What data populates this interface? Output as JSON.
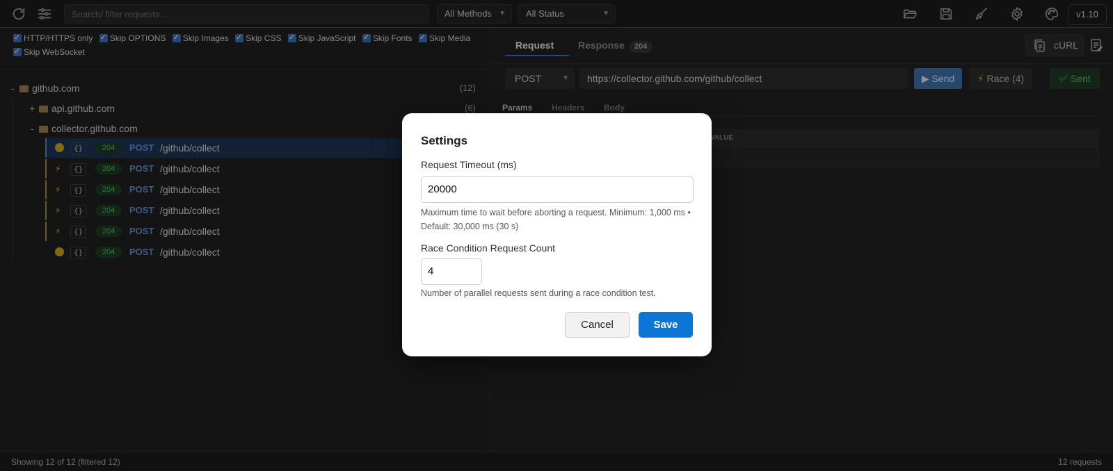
{
  "toolbar": {
    "search_placeholder": "Search/ filter requests...",
    "methods_filter": "All Methods",
    "status_filter": "All Status",
    "version": "v1.10",
    "icons": [
      "refresh-icon",
      "sliders-icon",
      "folder-open-icon",
      "save-icon",
      "broom-icon",
      "gear-icon",
      "palette-icon"
    ]
  },
  "filters": [
    {
      "label": "HTTP/HTTPS only",
      "checked": true
    },
    {
      "label": "Skip OPTIONS",
      "checked": true
    },
    {
      "label": "Skip Images",
      "checked": true
    },
    {
      "label": "Skip CSS",
      "checked": true
    },
    {
      "label": "Skip JavaScript",
      "checked": true
    },
    {
      "label": "Skip Fonts",
      "checked": true
    },
    {
      "label": "Skip Media",
      "checked": true
    },
    {
      "label": "Skip WebSocket",
      "checked": true
    }
  ],
  "tree": {
    "root": {
      "toggle": "-",
      "label": "github.com",
      "count": "(12)"
    },
    "children": [
      {
        "toggle": "+",
        "label": "api.github.com",
        "count": "(6)"
      },
      {
        "toggle": "-",
        "label": "collector.github.com",
        "count": ""
      }
    ],
    "requests": [
      {
        "marker": "dot",
        "type": "{}",
        "status": "204",
        "method": "POST",
        "path": "/github/collect",
        "selected": true
      },
      {
        "marker": "bolt",
        "type": "{}",
        "status": "204",
        "method": "POST",
        "path": "/github/collect",
        "selected": false
      },
      {
        "marker": "bolt",
        "type": "{}",
        "status": "204",
        "method": "POST",
        "path": "/github/collect",
        "selected": false
      },
      {
        "marker": "bolt",
        "type": "{}",
        "status": "204",
        "method": "POST",
        "path": "/github/collect",
        "selected": false
      },
      {
        "marker": "bolt",
        "type": "{}",
        "status": "204",
        "method": "POST",
        "path": "/github/collect",
        "selected": false
      },
      {
        "marker": "dot",
        "type": "{}",
        "status": "204",
        "method": "POST",
        "path": "/github/collect",
        "selected": false
      }
    ]
  },
  "request_panel": {
    "tabs": {
      "request": "Request",
      "response": "Response",
      "response_badge": "204"
    },
    "curl_label": "cURL",
    "method": "POST",
    "url": "https://collector.github.com/github/collect",
    "send_label": "Send",
    "race_label": "Race (4)",
    "sent_label": "Sent",
    "subtabs": {
      "params": "Params",
      "headers": "Headers",
      "body": "Body"
    },
    "params_value_header": "VALUE"
  },
  "statusbar": {
    "left": "Showing 12 of 12 (filtered 12)",
    "right": "12 requests"
  },
  "modal": {
    "title": "Settings",
    "timeout_label": "Request Timeout (ms)",
    "timeout_value": "20000",
    "timeout_help": "Maximum time to wait before aborting a request. Minimum: 1,000 ms • Default: 30,000 ms (30 s)",
    "race_label": "Race Condition Request Count",
    "race_value": "4",
    "race_help": "Number of parallel requests sent during a race condition test.",
    "cancel_label": "Cancel",
    "save_label": "Save"
  },
  "colors": {
    "accent": "#0d76d4",
    "selected_row": "#1e3453",
    "status_ok": "#4fb65f",
    "method": "#5b8fd0",
    "race_marker": "#d7a81d"
  }
}
